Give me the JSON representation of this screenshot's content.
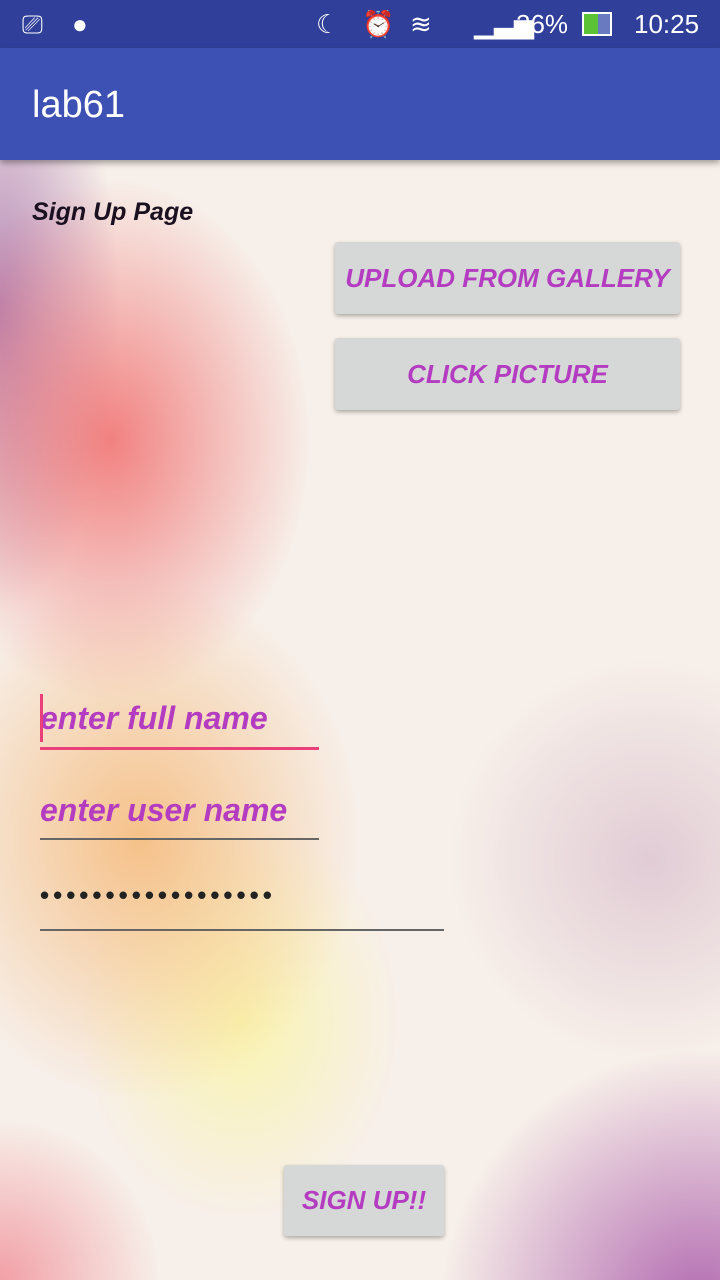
{
  "status_bar": {
    "battery": "36%",
    "time": "10:25",
    "icons": [
      "screen-cast-icon",
      "android-icon",
      "moon-icon",
      "alarm-icon",
      "wifi-icon",
      "signal-icon",
      "battery-charging-icon"
    ]
  },
  "app_bar": {
    "title": "lab61"
  },
  "page": {
    "heading": "Sign Up Page",
    "upload_button": "UPLOAD FROM GALLERY",
    "picture_button": "CLICK PICTURE",
    "fullname_placeholder": "enter full name",
    "username_placeholder": "enter user name",
    "password_mask": "••••••••••••••••••",
    "signup_button": "SIGN UP!!"
  },
  "colors": {
    "accent": "#e9407a",
    "primary": "#3d51b4",
    "button_text": "#b43cc0"
  }
}
